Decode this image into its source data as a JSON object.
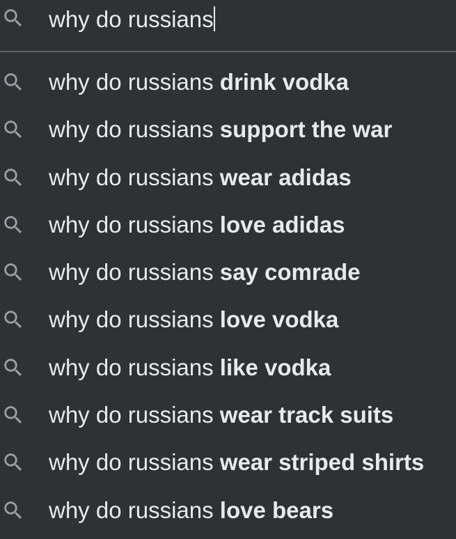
{
  "search": {
    "query": "why do russians",
    "icon": "search-icon"
  },
  "suggestions": [
    {
      "prefix": "why do russians",
      "completion": "drink vodka"
    },
    {
      "prefix": "why do russians",
      "completion": "support the war"
    },
    {
      "prefix": "why do russians",
      "completion": "wear adidas"
    },
    {
      "prefix": "why do russians",
      "completion": "love adidas"
    },
    {
      "prefix": "why do russians",
      "completion": "say comrade"
    },
    {
      "prefix": "why do russians",
      "completion": "love vodka"
    },
    {
      "prefix": "why do russians",
      "completion": "like vodka"
    },
    {
      "prefix": "why do russians",
      "completion": "wear track suits"
    },
    {
      "prefix": "why do russians",
      "completion": "wear striped shirts"
    },
    {
      "prefix": "why do russians",
      "completion": "love bears"
    }
  ],
  "colors": {
    "background": "#303134",
    "text": "#e8eaed",
    "icon": "#9aa0a6",
    "divider": "#5f6368"
  }
}
